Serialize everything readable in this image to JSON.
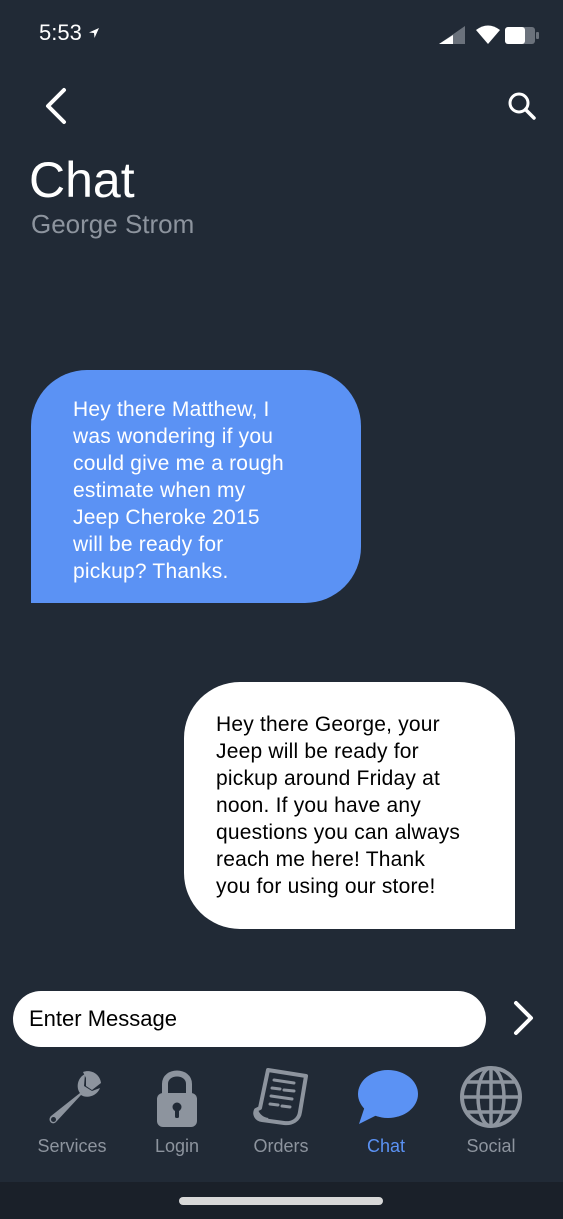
{
  "status_bar": {
    "time": "5:53"
  },
  "header": {
    "title": "Chat",
    "subtitle": "George Strom",
    "back_icon": "chevron-left-icon",
    "search_icon": "search-icon"
  },
  "messages": [
    {
      "direction": "incoming",
      "text": "Hey there Matthew, I was wondering if you could give me a rough estimate when my Jeep Cheroke 2015 will be ready for pickup? Thanks.",
      "lines": [
        "Hey there Matthew, I",
        "was wondering if you",
        "could give me a rough",
        "estimate when my",
        "Jeep Cheroke 2015",
        "will be ready for",
        "pickup? Thanks."
      ]
    },
    {
      "direction": "outgoing",
      "text": "Hey there George, your Jeep will be ready for pickup around Friday at noon. If you have any questions you can always reach me here! Thank you for using our store!",
      "lines": [
        "Hey there George, your",
        "Jeep will be ready for",
        "pickup around Friday at",
        "noon. If you have any",
        "questions you can always",
        "reach me here! Thank",
        "you for using our store!"
      ]
    }
  ],
  "composer": {
    "placeholder": "Enter Message",
    "send_icon": "chevron-right-icon"
  },
  "tabs": [
    {
      "label": "Services",
      "icon": "wrench-icon",
      "active": false
    },
    {
      "label": "Login",
      "icon": "lock-icon",
      "active": false
    },
    {
      "label": "Orders",
      "icon": "receipt-icon",
      "active": false
    },
    {
      "label": "Chat",
      "icon": "chat-bubble-icon",
      "active": true
    },
    {
      "label": "Social",
      "icon": "globe-icon",
      "active": false
    }
  ],
  "colors": {
    "background": "#212a36",
    "accent": "#5b92f4",
    "inactive": "#8d949e",
    "outgoing_bubble": "#ffffff"
  }
}
